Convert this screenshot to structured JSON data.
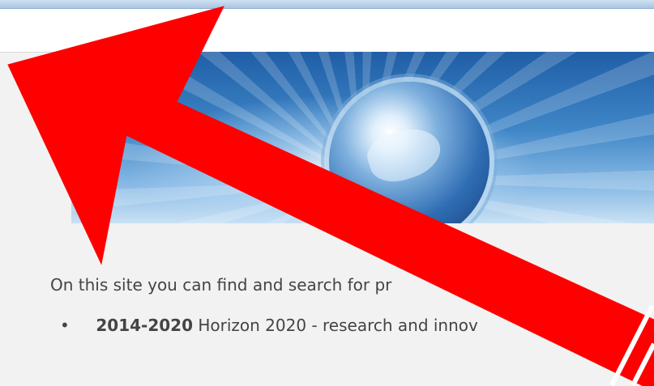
{
  "page": {
    "intro_text": "On this site you can find and search for pr",
    "programs": [
      {
        "years": "2014-2020",
        "description": "Horizon 2020 - research and innov"
      }
    ]
  },
  "colors": {
    "annotation_arrow": "#ff0000",
    "body_text": "#444444",
    "background": "#f2f2f2"
  },
  "icons": {
    "banner_image": "globe-icon",
    "annotation": "arrow-icon"
  }
}
